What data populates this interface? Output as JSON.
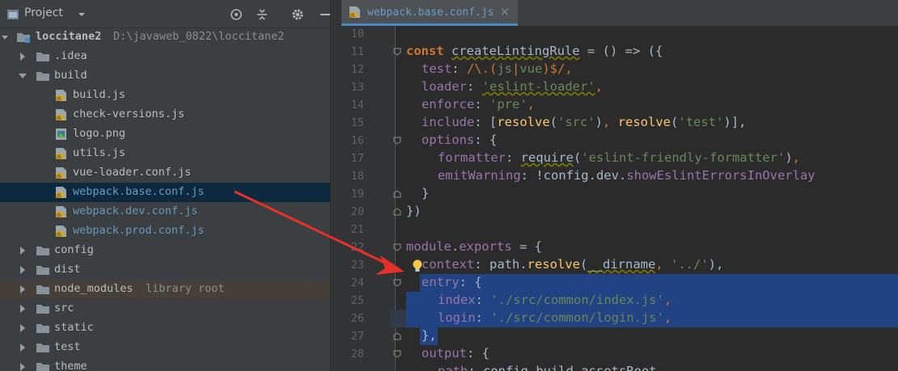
{
  "project_panel": {
    "title": "Project",
    "tree": [
      {
        "id": "root",
        "label": "loccitane2",
        "sub": "D:\\javaweb_0822\\loccitane2",
        "kind": "module",
        "expanded": true
      },
      {
        "id": "idea",
        "label": ".idea",
        "kind": "folder",
        "expanded": false
      },
      {
        "id": "build",
        "label": "build",
        "kind": "folder",
        "expanded": true
      },
      {
        "id": "build-js",
        "label": "build.js",
        "kind": "js"
      },
      {
        "id": "check-versions",
        "label": "check-versions.js",
        "kind": "js"
      },
      {
        "id": "logo",
        "label": "logo.png",
        "kind": "img"
      },
      {
        "id": "utils",
        "label": "utils.js",
        "kind": "js"
      },
      {
        "id": "vue-loader",
        "label": "vue-loader.conf.js",
        "kind": "js"
      },
      {
        "id": "webpack-base",
        "label": "webpack.base.conf.js",
        "kind": "js",
        "selected": true
      },
      {
        "id": "webpack-dev",
        "label": "webpack.dev.conf.js",
        "kind": "js"
      },
      {
        "id": "webpack-prod",
        "label": "webpack.prod.conf.js",
        "kind": "js"
      },
      {
        "id": "config",
        "label": "config",
        "kind": "folder",
        "expanded": false
      },
      {
        "id": "dist",
        "label": "dist",
        "kind": "folder",
        "expanded": false
      },
      {
        "id": "node_modules",
        "label": "node_modules",
        "sub": "library root",
        "kind": "folder",
        "expanded": false
      },
      {
        "id": "src",
        "label": "src",
        "kind": "folder",
        "expanded": false
      },
      {
        "id": "static",
        "label": "static",
        "kind": "folder",
        "expanded": false
      },
      {
        "id": "test",
        "label": "test",
        "kind": "folder",
        "expanded": false
      },
      {
        "id": "theme",
        "label": "theme",
        "kind": "folder",
        "expanded": false
      }
    ]
  },
  "editor": {
    "tab_label": "webpack.base.conf.js",
    "tab_close": "×",
    "line_numbers": [
      "10",
      "11",
      "12",
      "13",
      "14",
      "15",
      "16",
      "17",
      "18",
      "19",
      "20",
      "21",
      "22",
      "23",
      "24",
      "25",
      "26",
      "27",
      "28"
    ]
  },
  "code": {
    "l11_const": "const ",
    "l11_name": "createLintingRule",
    "l11_rest": " = () => ({",
    "l12_key": "test",
    "l12_colon": ": ",
    "l12_re_a": "/\\.(",
    "l12_re_b": "js",
    "l12_re_c": "|",
    "l12_re_d": "vue",
    "l12_re_e": ")$/",
    "l12_end": ",",
    "l13_key": "loader",
    "l13_val": "'eslint-loader'",
    "l14_key": "enforce",
    "l14_val": "'pre'",
    "l15_key": "include",
    "l15_open": ": [",
    "l15_fn1": "resolve",
    "l15_arg1": "'src'",
    "l15_fn2": "resolve",
    "l15_arg2": "'test'",
    "l15_end": ")],",
    "l16_key": "options",
    "l16_end": ": {",
    "l17_key": "formatter",
    "l17_fn": "require",
    "l17_arg": "'eslint-friendly-formatter'",
    "l18_key": "emitWarning",
    "l18_val": ": !config.dev.",
    "l18_prop": "showEslintErrorsInOverlay",
    "l19": "}",
    "l20": "})",
    "l22_a": "module",
    "l22_b": ".",
    "l22_c": "exports",
    "l22_d": " = {",
    "l23_key": "context",
    "l23_a": ": path.",
    "l23_fn": "resolve",
    "l23_b": "(",
    "l23_dir": "__dirname",
    "l23_c": ", ",
    "l23_str": "'../'",
    "l23_d": "),",
    "l24_key": "entry",
    "l24_end": ": {",
    "l25_key": "index",
    "l25_val": "'./src/common/index.js'",
    "l26_key": "login",
    "l26_val": "'./src/common/login.js'",
    "l27": "},",
    "l28_key": "output",
    "l28_end": ": {",
    "l29_key": "path",
    "l29_val": ": config.build.assetsRoot,"
  },
  "colors": {
    "accent": "#4a88c7",
    "arrow": "#e8302b",
    "selection": "#214283"
  }
}
